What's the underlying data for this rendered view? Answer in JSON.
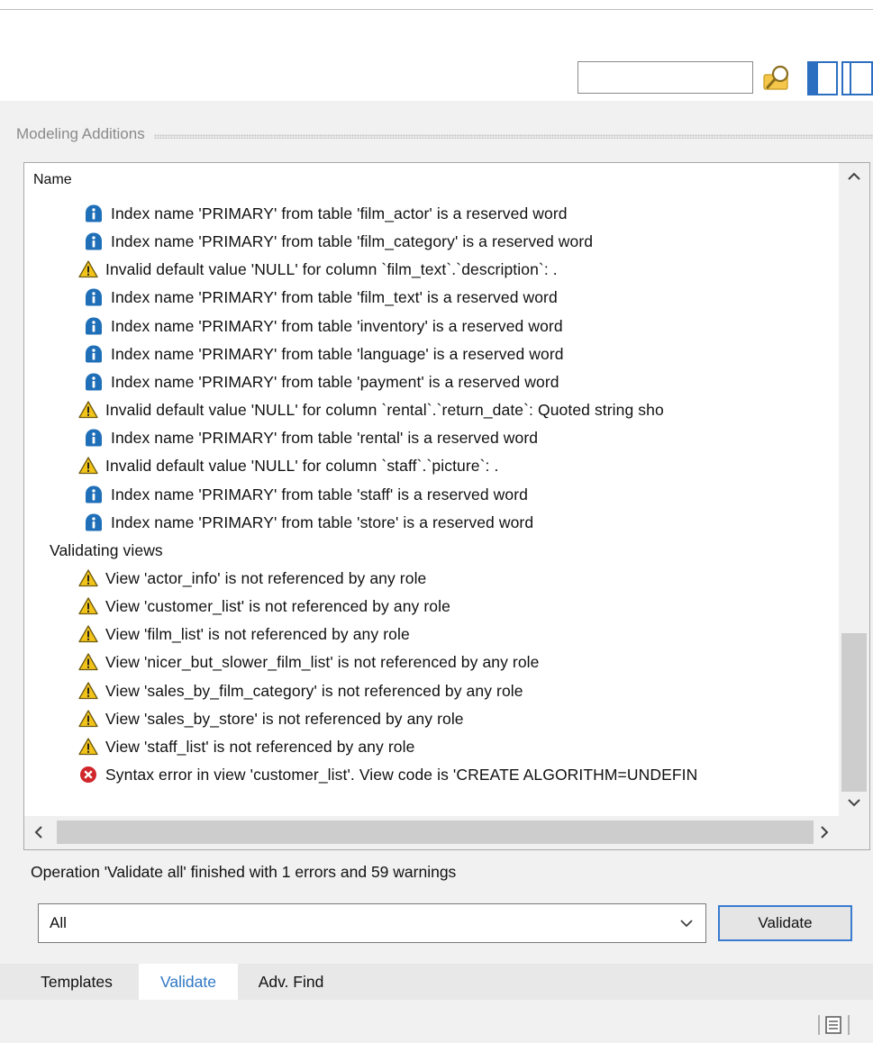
{
  "toolbar": {
    "search_value": "",
    "search_icon": "search-magnifier-icon",
    "layout_icons": [
      "single-panel-icon",
      "dual-panel-icon"
    ]
  },
  "section": {
    "title": "Modeling Additions"
  },
  "tree": {
    "column_header": "Name",
    "rows": [
      {
        "icon": "info-icon",
        "text": "Index name 'PRIMARY' from table 'film_actor' is a reserved word"
      },
      {
        "icon": "info-icon",
        "text": "Index name 'PRIMARY' from table 'film_category' is a reserved word"
      },
      {
        "icon": "warning-icon",
        "text": "Invalid default value 'NULL' for column `film_text`.`description`: ."
      },
      {
        "icon": "info-icon",
        "text": "Index name 'PRIMARY' from table 'film_text' is a reserved word"
      },
      {
        "icon": "info-icon",
        "text": "Index name 'PRIMARY' from table 'inventory' is a reserved word"
      },
      {
        "icon": "info-icon",
        "text": "Index name 'PRIMARY' from table 'language' is a reserved word"
      },
      {
        "icon": "info-icon",
        "text": "Index name 'PRIMARY' from table 'payment' is a reserved word"
      },
      {
        "icon": "warning-icon",
        "text": "Invalid default value 'NULL' for column `rental`.`return_date`: Quoted string sho"
      },
      {
        "icon": "info-icon",
        "text": "Index name 'PRIMARY' from table 'rental' is a reserved word"
      },
      {
        "icon": "warning-icon",
        "text": "Invalid default value 'NULL' for column `staff`.`picture`: ."
      },
      {
        "icon": "info-icon",
        "text": "Index name 'PRIMARY' from table 'staff' is a reserved word"
      },
      {
        "icon": "info-icon",
        "text": "Index name 'PRIMARY' from table 'store' is a reserved word"
      },
      {
        "icon": "",
        "text": "Validating views",
        "group": true
      },
      {
        "icon": "warning-icon",
        "text": "View 'actor_info' is not referenced by any role"
      },
      {
        "icon": "warning-icon",
        "text": "View 'customer_list' is not referenced by any role"
      },
      {
        "icon": "warning-icon",
        "text": "View 'film_list' is not referenced by any role"
      },
      {
        "icon": "warning-icon",
        "text": "View 'nicer_but_slower_film_list' is not referenced by any role"
      },
      {
        "icon": "warning-icon",
        "text": "View 'sales_by_film_category' is not referenced by any role"
      },
      {
        "icon": "warning-icon",
        "text": "View 'sales_by_store' is not referenced by any role"
      },
      {
        "icon": "warning-icon",
        "text": "View 'staff_list' is not referenced by any role"
      },
      {
        "icon": "error-icon",
        "text": "Syntax error in view 'customer_list'. View code is 'CREATE ALGORITHM=UNDEFIN"
      }
    ]
  },
  "status": {
    "text": "Operation 'Validate all' finished with 1 errors and 59 warnings"
  },
  "filter": {
    "selected": "All"
  },
  "actions": {
    "validate_label": "Validate"
  },
  "tabs": [
    {
      "label": "Templates",
      "active": false
    },
    {
      "label": "Validate",
      "active": true
    },
    {
      "label": "Adv. Find",
      "active": false
    }
  ],
  "colors": {
    "info": "#1f6fb8",
    "warning": "#f2c318",
    "error": "#d0262b",
    "active_tab": "#2f78c4",
    "button_border": "#3b7bd0"
  }
}
